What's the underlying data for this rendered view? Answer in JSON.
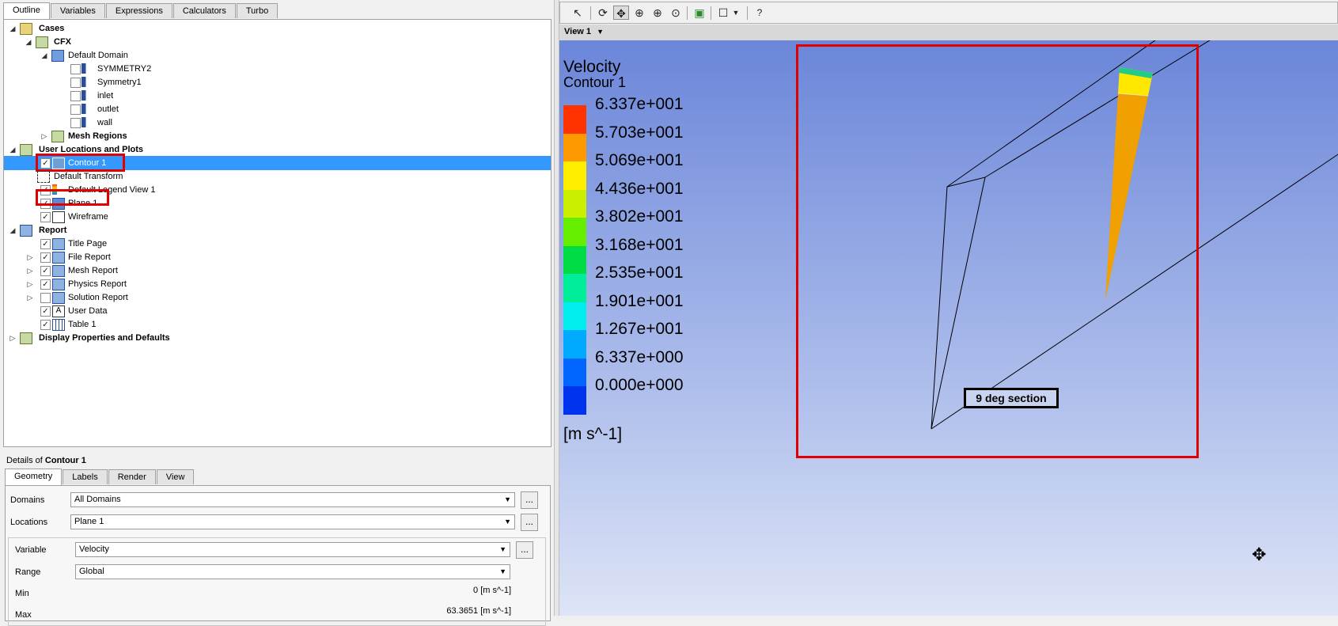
{
  "outline_tabs": [
    "Outline",
    "Variables",
    "Expressions",
    "Calculators",
    "Turbo"
  ],
  "tree": {
    "cases": "Cases",
    "cfx": "CFX",
    "default_domain": "Default Domain",
    "boundaries": [
      "SYMMETRY2",
      "Symmetry1",
      "inlet",
      "outlet",
      "wall"
    ],
    "mesh_regions": "Mesh Regions",
    "user_locations": "User Locations and Plots",
    "contour1": "Contour 1",
    "default_transform": "Default Transform",
    "default_legend": "Default Legend View 1",
    "plane1": "Plane 1",
    "wireframe": "Wireframe",
    "report": "Report",
    "report_items": [
      "Title Page",
      "File Report",
      "Mesh Report",
      "Physics Report",
      "Solution Report",
      "User Data",
      "Table 1"
    ],
    "display_props": "Display Properties and Defaults"
  },
  "details": {
    "prefix": "Details of ",
    "object": "Contour 1",
    "tabs": [
      "Geometry",
      "Labels",
      "Render",
      "View"
    ],
    "domains_label": "Domains",
    "domains_value": "All Domains",
    "locations_label": "Locations",
    "locations_value": "Plane 1",
    "variable_label": "Variable",
    "variable_value": "Velocity",
    "range_label": "Range",
    "range_value": "Global",
    "min_label": "Min",
    "min_value": "0 [m s^-1]",
    "max_label": "Max",
    "max_value": "63.3651 [m s^-1]",
    "dots": "..."
  },
  "viewer": {
    "view_name": "View 1",
    "legend_title": "Velocity",
    "legend_subtitle": "Contour 1",
    "legend_values": [
      "6.337e+001",
      "5.703e+001",
      "5.069e+001",
      "4.436e+001",
      "3.802e+001",
      "3.168e+001",
      "2.535e+001",
      "1.901e+001",
      "1.267e+001",
      "6.337e+000",
      "0.000e+000"
    ],
    "legend_colors": [
      "#ff3300",
      "#ff9900",
      "#ffee00",
      "#ccee00",
      "#66ee00",
      "#00dd44",
      "#00ee99",
      "#00eeee",
      "#00aaff",
      "#0066ff",
      "#0033ee"
    ],
    "legend_unit": "[m s^-1]",
    "annotation": "9 deg section"
  },
  "colors": {
    "selection": "#3399ff",
    "highlight_box": "#e00000"
  }
}
